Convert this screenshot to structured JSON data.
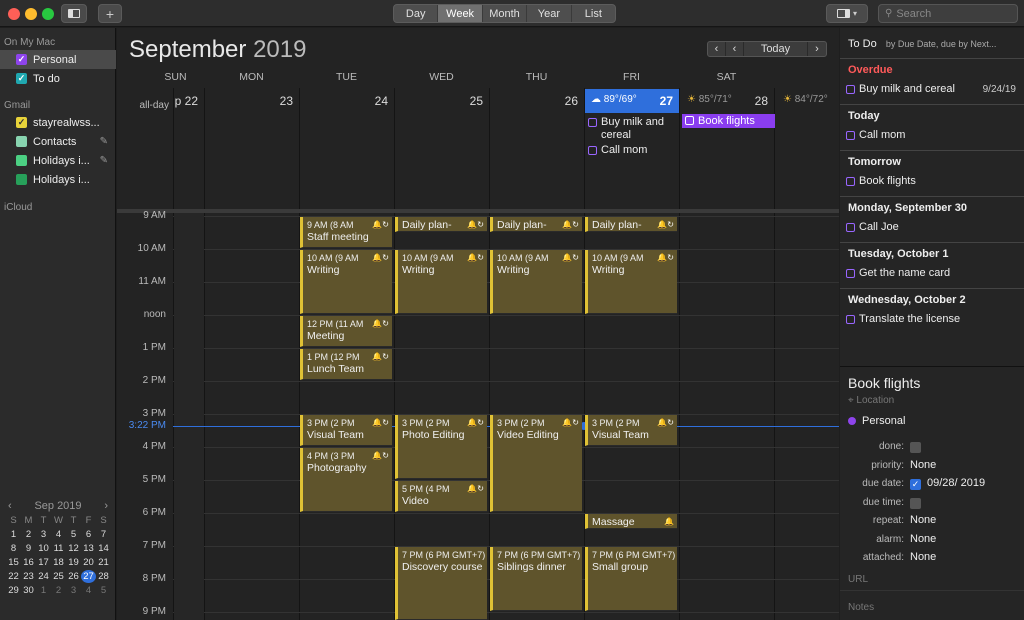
{
  "toolbar": {
    "views": [
      "Day",
      "Week",
      "Month",
      "Year",
      "List"
    ],
    "selected_view": "Week",
    "search_placeholder": "Search",
    "add_label": "+"
  },
  "sidebar": {
    "sections": [
      {
        "label": "On My Mac"
      },
      {
        "label": "Gmail"
      },
      {
        "label": "iCloud"
      }
    ],
    "calendars": [
      {
        "label": "Personal",
        "color": "#8e44ec",
        "checked": "✓"
      },
      {
        "label": "To do",
        "color": "#20a8b0",
        "checked": "✓"
      },
      {
        "label": "stayrealwss...",
        "color": "#e8d33a",
        "checked": "✓"
      },
      {
        "label": "Contacts",
        "color": "#88d4b0",
        "checked": ""
      },
      {
        "label": "Holidays i...",
        "color": "#4cd083",
        "checked": ""
      },
      {
        "label": "Holidays i...",
        "color": "#27a05a",
        "checked": ""
      }
    ],
    "minical": {
      "title": "Sep 2019",
      "prev": "‹",
      "next": "›",
      "weekdays": [
        "S",
        "M",
        "T",
        "W",
        "T",
        "F",
        "S"
      ],
      "days": [
        "1",
        "2",
        "3",
        "4",
        "5",
        "6",
        "7",
        "8",
        "9",
        "10",
        "11",
        "12",
        "13",
        "14",
        "15",
        "16",
        "17",
        "18",
        "19",
        "20",
        "21",
        "22",
        "23",
        "24",
        "25",
        "26",
        "27",
        "28",
        "29",
        "30",
        "1",
        "2",
        "3",
        "4",
        "5"
      ],
      "today": "27"
    }
  },
  "calendar": {
    "month": "September",
    "year": "2019",
    "nav": {
      "prev": "‹",
      "prev2": "‹",
      "today": "Today",
      "next": "›"
    },
    "allday_label": "all-day",
    "days": [
      {
        "name": "SUN",
        "num": "p 22"
      },
      {
        "name": "MON",
        "num": "23"
      },
      {
        "name": "TUE",
        "num": "24"
      },
      {
        "name": "WED",
        "num": "25"
      },
      {
        "name": "THU",
        "num": "26"
      },
      {
        "name": "FRI",
        "num": "27"
      },
      {
        "name": "SAT",
        "num": "28"
      }
    ],
    "weather": {
      "fri": "89°/69°",
      "sat": "85°/71°",
      "sun2": "84°/72°"
    },
    "allday_tasks": [
      {
        "label": "Buy milk and cereal"
      },
      {
        "label": "Call mom"
      }
    ],
    "allday_event": "Book flights",
    "hours": [
      "9 AM",
      "10 AM",
      "11 AM",
      "noon",
      "1 PM",
      "2 PM",
      "3 PM",
      "4 PM",
      "5 PM",
      "6 PM",
      "7 PM",
      "8 PM",
      "9 PM"
    ],
    "now_label": "3:22 PM",
    "events": [
      {
        "time": "9 AM (8 AM",
        "name": "Staff meeting"
      },
      {
        "time": "",
        "name": "Daily plan-"
      },
      {
        "time": "",
        "name": "Daily plan-"
      },
      {
        "time": "",
        "name": "Daily plan-"
      },
      {
        "time": "10 AM (9 AM",
        "name": "Writing"
      },
      {
        "time": "10 AM (9 AM",
        "name": "Writing"
      },
      {
        "time": "10 AM (9 AM",
        "name": "Writing"
      },
      {
        "time": "10 AM (9 AM",
        "name": "Writing"
      },
      {
        "time": "12 PM (11 AM",
        "name": "Meeting"
      },
      {
        "time": "1 PM (12 PM",
        "name": "Lunch Team"
      },
      {
        "time": "3 PM (2 PM",
        "name": "Visual Team"
      },
      {
        "time": "3 PM (2 PM",
        "name": "Photo Editing"
      },
      {
        "time": "3 PM (2 PM",
        "name": "Video Editing"
      },
      {
        "time": "3 PM (2 PM",
        "name": "Visual Team"
      },
      {
        "time": "4 PM (3 PM",
        "name": "Photography"
      },
      {
        "time": "5 PM (4 PM",
        "name": "Video"
      },
      {
        "time": "",
        "name": "Massage"
      },
      {
        "time": "7 PM (6 PM GMT+7)",
        "name": "Discovery course"
      },
      {
        "time": "7 PM (6 PM GMT+7)",
        "name": "Siblings dinner"
      },
      {
        "time": "7 PM (6 PM GMT+7)",
        "name": "Small group"
      }
    ]
  },
  "todo": {
    "title": "To Do",
    "sort": "by Due Date, due by Next...",
    "groups": [
      {
        "label": "Overdue",
        "items": [
          {
            "label": "Buy milk and cereal",
            "date": "9/24/19"
          }
        ]
      },
      {
        "label": "Today",
        "items": [
          {
            "label": "Call mom"
          }
        ]
      },
      {
        "label": "Tomorrow",
        "items": [
          {
            "label": "Book flights"
          }
        ]
      },
      {
        "label": "Monday, September 30",
        "items": [
          {
            "label": "Call Joe"
          }
        ]
      },
      {
        "label": "Tuesday, October 1",
        "items": [
          {
            "label": "Get the name card"
          }
        ]
      },
      {
        "label": "Wednesday, October 2",
        "items": [
          {
            "label": "Translate the license"
          }
        ]
      }
    ]
  },
  "detail": {
    "title": "Book flights",
    "location_placeholder": "Location",
    "calendar": "Personal",
    "fields": [
      {
        "label": "done:",
        "value": ""
      },
      {
        "label": "priority:",
        "value": "None"
      },
      {
        "label": "due date:",
        "value": "09/28/ 2019"
      },
      {
        "label": "due time:",
        "value": ""
      },
      {
        "label": "repeat:",
        "value": "None"
      },
      {
        "label": "alarm:",
        "value": "None"
      },
      {
        "label": "attached:",
        "value": "None"
      }
    ],
    "url_placeholder": "URL",
    "notes_placeholder": "Notes"
  }
}
